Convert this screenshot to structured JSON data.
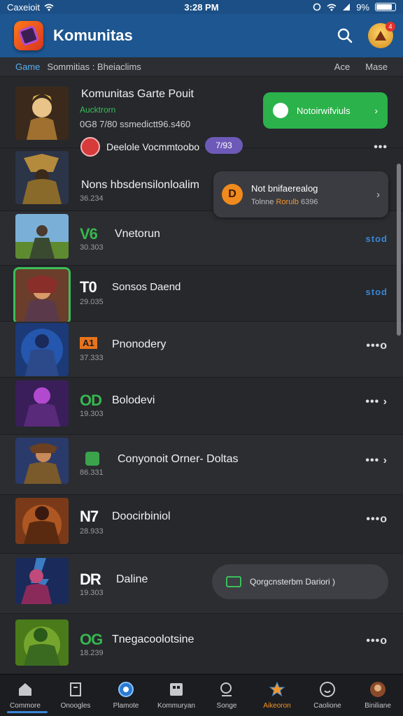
{
  "status": {
    "carrier": "Caxeioit",
    "time": "3:28 PM",
    "battery": "9%"
  },
  "appbar": {
    "title": "Komunitas",
    "notif_badge": "4"
  },
  "tabs": {
    "active": "Game",
    "breadcrumb": "Sommitias : Bheiaclims",
    "right1": "Ace",
    "right2": "Mase"
  },
  "rows": [
    {
      "title": "Komunitas Garte Pouit",
      "subtitle": "Aucktrorn",
      "code": "0G8 7/80 ssmedictt96.s460",
      "extra": "Deelole Vocmmtoobo",
      "tag": "7/93",
      "more": "•••"
    },
    {
      "title": "Nons hbsdensilonloalim",
      "code": "36.234",
      "more": ""
    },
    {
      "badge": "V6",
      "title": "Vnetorun",
      "code": "30.303",
      "more": "stod"
    },
    {
      "badge": "T0",
      "title": "Sonsos Daend",
      "code": "29.035",
      "more": "stod"
    },
    {
      "badge": "A1",
      "title": "Pnonodery",
      "code": "37.333",
      "more": "•••o"
    },
    {
      "badge": "OD",
      "title": "Bolodevi",
      "code": "19.303",
      "more": "••• ›"
    },
    {
      "badge": "",
      "title": "Conyonoit Orner- Doltas",
      "code": "86.331",
      "more": "••• ›"
    },
    {
      "badge": "N7",
      "title": "Doocirbiniol",
      "code": "28.933",
      "more": "•••o"
    },
    {
      "badge": "DR",
      "title": "Daline",
      "code": "19.303",
      "more": ""
    },
    {
      "badge": "OG",
      "title": "Tnegacoolotsine",
      "code": "18.239",
      "more": "•••o"
    }
  ],
  "notice_pill": {
    "label": "Notoirwifviuls",
    "arrow": "›"
  },
  "tip": {
    "icon_letter": "D",
    "title": "Not bnifaerealog",
    "line_prefix": "Tolnne",
    "line_highlight": "Rorulb",
    "line_suffix": "6396",
    "arrow": "›"
  },
  "toast": {
    "label": "Qorgcnsterbm Dariori )"
  },
  "nav": [
    {
      "label": "Commore",
      "icon": "home-icon"
    },
    {
      "label": "Onoogles",
      "icon": "document-icon"
    },
    {
      "label": "Plamote",
      "icon": "globe-icon"
    },
    {
      "label": "Kommuryan",
      "icon": "grid-icon"
    },
    {
      "label": "Songe",
      "icon": "search-icon"
    },
    {
      "label": "Aikeoron",
      "icon": "star-icon"
    },
    {
      "label": "Caolione",
      "icon": "smile-icon"
    },
    {
      "label": "Biniliane",
      "icon": "avatar-icon"
    }
  ],
  "colors": {
    "accent_green": "#2bb24a",
    "accent_blue": "#1d5690",
    "accent_orange": "#f0962a"
  }
}
